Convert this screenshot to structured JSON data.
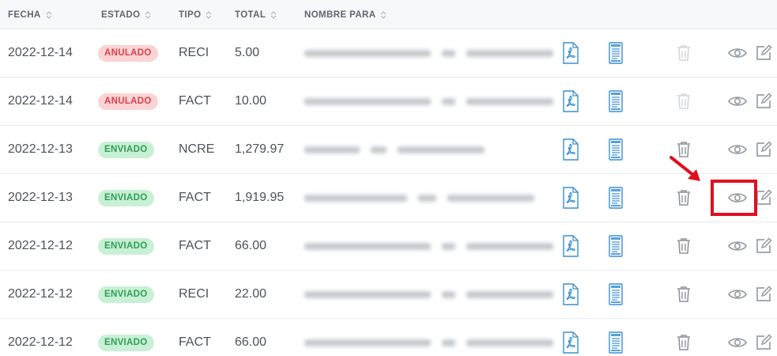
{
  "headers": {
    "fecha": "FECHA",
    "estado": "ESTADO",
    "tipo": "TIPO",
    "total": "TOTAL",
    "nombre": "NOMBRE PARA"
  },
  "colors": {
    "anulado_bg": "#fbd3d5",
    "anulado_text": "#d9414a",
    "enviado_bg": "#c8f0d4",
    "enviado_text": "#2e9e58",
    "doc_icon": "#3a8fd0",
    "highlight": "#e0101f"
  },
  "icons": [
    "sort-icon",
    "pdf-icon",
    "xml-document-icon",
    "trash-icon",
    "eye-icon",
    "edit-icon"
  ],
  "rows": [
    {
      "fecha": "2022-12-14",
      "estado": "ANULADO",
      "status": "anulado",
      "tipo": "RECI",
      "total": "5.00",
      "delete_enabled": false
    },
    {
      "fecha": "2022-12-14",
      "estado": "ANULADO",
      "status": "anulado",
      "tipo": "FACT",
      "total": "10.00",
      "delete_enabled": false
    },
    {
      "fecha": "2022-12-13",
      "estado": "ENVIADO",
      "status": "enviado",
      "tipo": "NCRE",
      "total": "1,279.97",
      "delete_enabled": true
    },
    {
      "fecha": "2022-12-13",
      "estado": "ENVIADO",
      "status": "enviado",
      "tipo": "FACT",
      "total": "1,919.95",
      "delete_enabled": true
    },
    {
      "fecha": "2022-12-12",
      "estado": "ENVIADO",
      "status": "enviado",
      "tipo": "FACT",
      "total": "66.00",
      "delete_enabled": true
    },
    {
      "fecha": "2022-12-12",
      "estado": "ENVIADO",
      "status": "enviado",
      "tipo": "RECI",
      "total": "22.00",
      "delete_enabled": true
    },
    {
      "fecha": "2022-12-12",
      "estado": "ENVIADO",
      "status": "enviado",
      "tipo": "FACT",
      "total": "66.00",
      "delete_enabled": true
    }
  ]
}
